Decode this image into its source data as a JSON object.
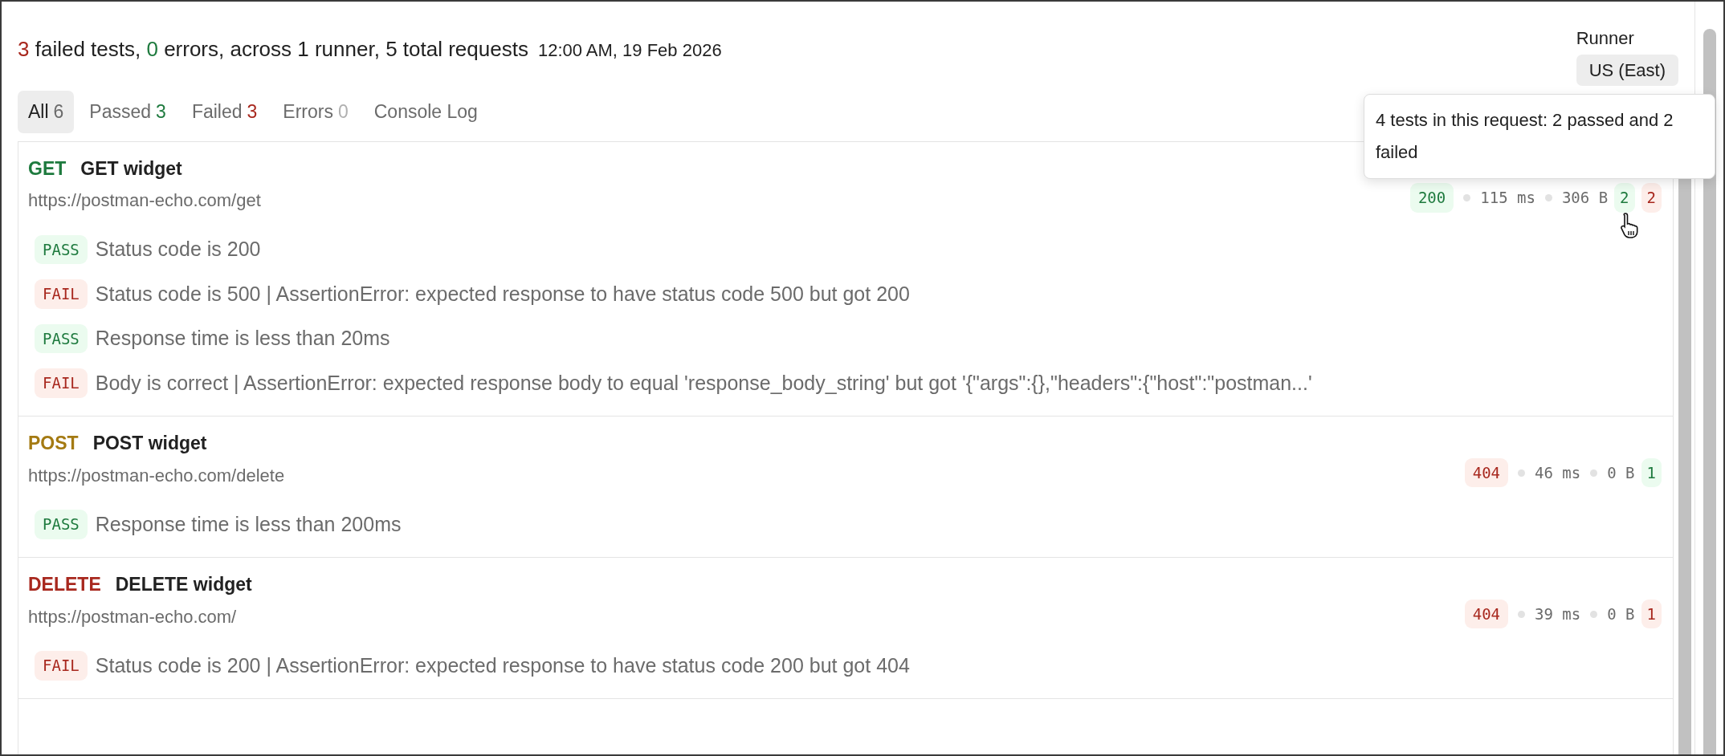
{
  "summary": {
    "segments": [
      {
        "text": "3",
        "kind": "failed"
      },
      {
        "text": " failed tests, ",
        "kind": "plain"
      },
      {
        "text": "0",
        "kind": "passed"
      },
      {
        "text": " errors, across 1 runner, 5 total requests",
        "kind": "plain"
      }
    ],
    "timestamp": "12:00 AM, 19 Feb 2026"
  },
  "runner": {
    "label": "Runner",
    "value": "US (East)"
  },
  "tabs": [
    {
      "label": "All",
      "count": "6",
      "color": "#6b6b6b",
      "selected": true
    },
    {
      "label": "Passed",
      "count": "3",
      "color": "#1e7a3e",
      "selected": false
    },
    {
      "label": "Failed",
      "count": "3",
      "color": "#a8281e",
      "selected": false
    },
    {
      "label": "Errors",
      "count": "0",
      "color": "#b0b0b0",
      "selected": false
    },
    {
      "label": "Console Log",
      "selected": false
    }
  ],
  "tooltip": {
    "text": "4 tests in this request: 2 passed and 2 failed"
  },
  "requests": [
    {
      "method": "GET",
      "name": "GET widget",
      "url": "https://postman-echo.com/get",
      "status": "200",
      "status_ok": true,
      "time": "115 ms",
      "size": "306 B",
      "passed_count": "2",
      "failed_count": "2",
      "tests": [
        {
          "result": "PASS",
          "text": "Status code is 200"
        },
        {
          "result": "FAIL",
          "text": "Status code is 500 | AssertionError: expected response to have status code 500 but got 200"
        },
        {
          "result": "PASS",
          "text": "Response time is less than 20ms"
        },
        {
          "result": "FAIL",
          "text": "Body is correct | AssertionError: expected response body to equal 'response_body_string' but got '{\"args\":{},\"headers\":{\"host\":\"postman...'"
        }
      ]
    },
    {
      "method": "POST",
      "name": "POST widget",
      "url": "https://postman-echo.com/delete",
      "status": "404",
      "status_ok": false,
      "time": "46 ms",
      "size": "0 B",
      "passed_count": "1",
      "tests": [
        {
          "result": "PASS",
          "text": "Response time is less than 200ms"
        }
      ]
    },
    {
      "method": "DELETE",
      "name": "DELETE widget",
      "url": "https://postman-echo.com/",
      "status": "404",
      "status_ok": false,
      "time": "39 ms",
      "size": "0 B",
      "failed_count": "1",
      "tests": [
        {
          "result": "FAIL",
          "text": "Status code is 200 | AssertionError: expected response to have status code 200 but got 404"
        }
      ]
    }
  ]
}
